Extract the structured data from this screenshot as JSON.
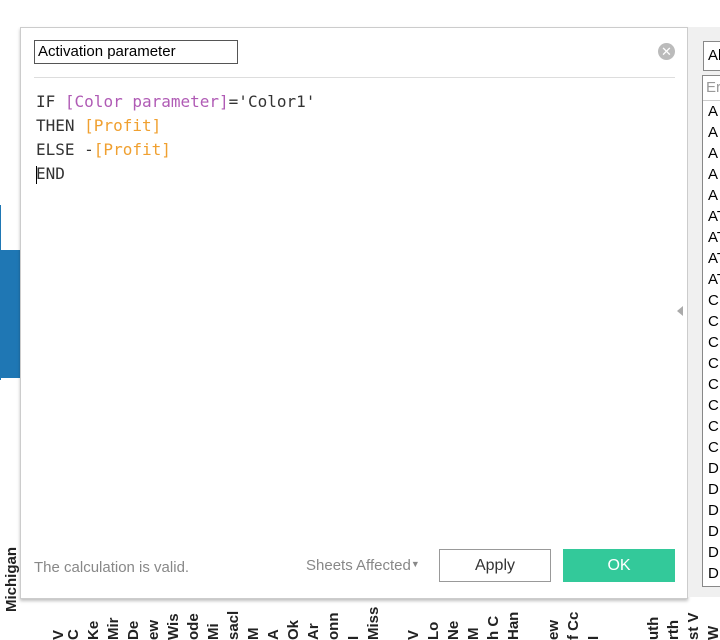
{
  "background": {
    "axis_labels": [
      "Michigan",
      "V",
      "C",
      "Ke",
      "Mir",
      "De",
      "ew",
      "Wis",
      "ode",
      "Mi",
      "sacl",
      "M",
      "A",
      "Ok",
      "Ar",
      "onn",
      "I",
      "Miss",
      "V",
      "Lo",
      "Ne",
      "M",
      "h C",
      "Han",
      "ew",
      "f Cc",
      "I",
      "uth",
      "rth",
      "st V",
      "W"
    ]
  },
  "dialog": {
    "calc_name": "Activation parameter",
    "code": [
      [
        {
          "t": "IF ",
          "c": "k"
        },
        {
          "t": "[Color parameter]",
          "c": "param"
        },
        {
          "t": "='Color1'",
          "c": "k"
        }
      ],
      [
        {
          "t": "THEN ",
          "c": "k"
        },
        {
          "t": "[Profit]",
          "c": "field"
        }
      ],
      [
        {
          "t": "ELSE -",
          "c": "k"
        },
        {
          "t": "[Profit]",
          "c": "field"
        }
      ],
      [
        {
          "t": "END",
          "c": "k"
        }
      ]
    ],
    "status": "The calculation is valid.",
    "sheets_affected": "Sheets Affected",
    "apply": "Apply",
    "ok": "OK"
  },
  "side_panel": {
    "select": "Al",
    "search_placeholder": "Er",
    "functions": [
      "A",
      "A",
      "A",
      "A",
      "A",
      "AT",
      "AT",
      "AT",
      "AT",
      "C",
      "C",
      "C",
      "C",
      "C",
      "C",
      "C",
      "C",
      "D",
      "D",
      "D",
      "D",
      "D",
      "D"
    ]
  },
  "colors": {
    "ok": "#33c99a",
    "field": "#f0a030",
    "param": "#b05bb5",
    "bar": "#1f77b4"
  }
}
